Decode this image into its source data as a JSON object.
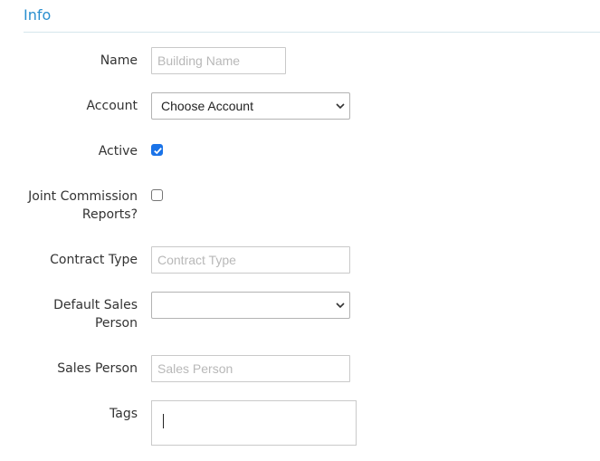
{
  "section": {
    "title": "Info"
  },
  "form": {
    "name": {
      "label": "Name",
      "placeholder": "Building Name",
      "value": ""
    },
    "account": {
      "label": "Account",
      "selected": "Choose Account"
    },
    "active": {
      "label": "Active",
      "checked": true
    },
    "joint_commission": {
      "label_line1": "Joint Commission",
      "label_line2": "Reports?",
      "checked": false
    },
    "contract_type": {
      "label": "Contract Type",
      "placeholder": "Contract Type",
      "value": ""
    },
    "default_sales_person": {
      "label_line1": "Default Sales",
      "label_line2": "Person",
      "selected": ""
    },
    "sales_person": {
      "label": "Sales Person",
      "placeholder": "Sales Person",
      "value": ""
    },
    "tags": {
      "label": "Tags",
      "value": ""
    }
  },
  "colors": {
    "accent": "#2a8fcf",
    "checkbox_checked": "#1a73e8",
    "rule": "#d5e7ec"
  },
  "icons": {
    "select_arrow": "chevron-down-icon",
    "checkmark": "check-icon"
  }
}
